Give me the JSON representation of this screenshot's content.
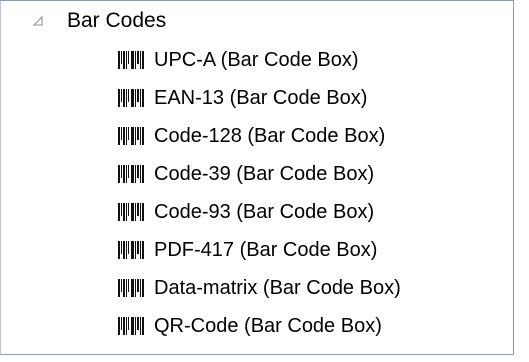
{
  "tree": {
    "root": {
      "label": "Bar Codes",
      "expanded": true
    },
    "items": [
      {
        "label": "UPC-A (Bar Code Box)",
        "icon": "barcode-icon"
      },
      {
        "label": "EAN-13 (Bar Code Box)",
        "icon": "barcode-icon"
      },
      {
        "label": "Code-128 (Bar Code Box)",
        "icon": "barcode-icon"
      },
      {
        "label": "Code-39 (Bar Code Box)",
        "icon": "barcode-icon"
      },
      {
        "label": "Code-93 (Bar Code Box)",
        "icon": "barcode-icon"
      },
      {
        "label": "PDF-417 (Bar Code Box)",
        "icon": "barcode-icon"
      },
      {
        "label": "Data-matrix (Bar Code Box)",
        "icon": "barcode-icon"
      },
      {
        "label": "QR-Code (Bar Code Box)",
        "icon": "barcode-icon"
      }
    ]
  }
}
